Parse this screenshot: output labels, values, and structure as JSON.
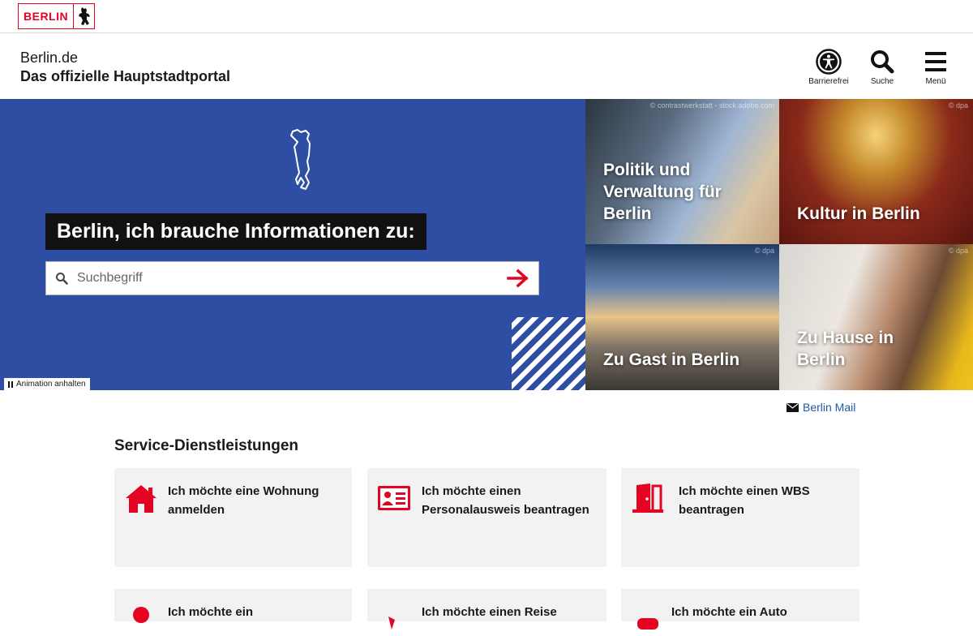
{
  "logo": {
    "text": "BERLIN",
    "icon": "bear-icon"
  },
  "header": {
    "line1": "Berlin.de",
    "line2": "Das offizielle Hauptstadtportal",
    "icons": [
      {
        "name": "accessibility-icon",
        "label": "Barrierefrei"
      },
      {
        "name": "search-icon",
        "label": "Suche"
      },
      {
        "name": "menu-icon",
        "label": "Menü"
      }
    ]
  },
  "hero": {
    "question": "Berlin, ich brauche Informationen zu:",
    "search_placeholder": "Suchbegriff",
    "pause_label": "Animation anhalten",
    "tiles": [
      {
        "label": "Politik und Verwaltung für Berlin",
        "credit": "© contrastwerkstatt - stock.adobe.com"
      },
      {
        "label": "Kultur in Berlin",
        "credit": "© dpa"
      },
      {
        "label": "Zu Gast in Berlin",
        "credit": "© dpa"
      },
      {
        "label": "Zu Hause in Berlin",
        "credit": "© dpa"
      }
    ],
    "accent_color": "#2d4ea2"
  },
  "mail": {
    "label": "Berlin Mail",
    "icon": "envelope-icon"
  },
  "services": {
    "title": "Service-Dienstleistungen",
    "icon_color": "#e40422",
    "cards": [
      {
        "label_line1": "Ich möchte eine Wohnung",
        "label_line2": "anmelden",
        "icon": "house-icon"
      },
      {
        "label_line1": "Ich möchte einen",
        "label_line2": "Personalausweis beantragen",
        "icon": "id-card-icon"
      },
      {
        "label_line1": "Ich möchte einen WBS",
        "label_line2": "beantragen",
        "icon": "door-icon"
      },
      {
        "label_line1": "Ich möchte ein",
        "label_line2": "",
        "icon": "pin-icon"
      },
      {
        "label_line1": "Ich möchte einen Reise",
        "label_line2": "",
        "icon": "passport-icon"
      },
      {
        "label_line1": "Ich möchte ein Auto",
        "label_line2": "",
        "icon": "car-icon"
      }
    ]
  }
}
